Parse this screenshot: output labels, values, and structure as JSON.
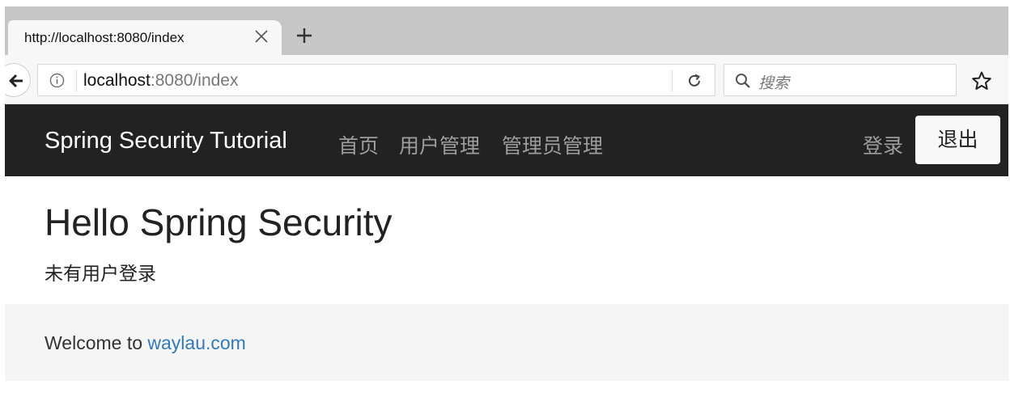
{
  "browser": {
    "tab_title": "http://localhost:8080/index",
    "url_host": "localhost",
    "url_rest": ":8080/index",
    "search_placeholder": "搜索"
  },
  "navbar": {
    "brand": "Spring Security Tutorial",
    "links": [
      "首页",
      "用户管理",
      "管理员管理"
    ],
    "login_label": "登录",
    "logout_label": "退出"
  },
  "main": {
    "title": "Hello Spring Security",
    "status": "未有用户登录"
  },
  "footer": {
    "prefix": "Welcome to ",
    "link_text": "waylau.com"
  },
  "colors": {
    "navbar_bg": "#222222",
    "nav_link": "#9d9d9d",
    "link": "#337ab7",
    "footer_bg": "#f5f5f5"
  }
}
